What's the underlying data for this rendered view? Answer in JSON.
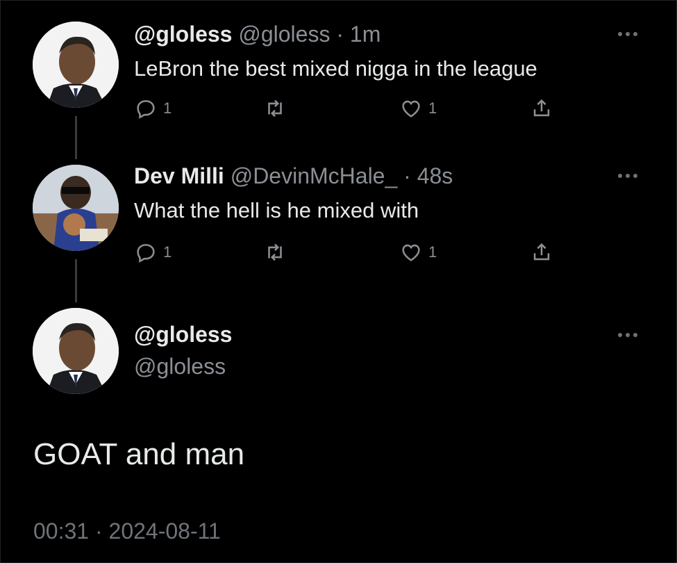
{
  "tweets": [
    {
      "name": "@gloless",
      "handle": "@gloless",
      "separator": "·",
      "time": "1m",
      "text": "LeBron the best mixed nigga in the league",
      "reply_count": "1",
      "like_count": "1"
    },
    {
      "name": "Dev Milli",
      "handle": "@DevinMcHale_",
      "separator": "·",
      "time": "48s",
      "text": "What the hell is he mixed with",
      "reply_count": "1",
      "like_count": "1"
    }
  ],
  "main": {
    "name": "@gloless",
    "handle": "@gloless",
    "text": "GOAT and man",
    "timestamp": "00:31 · 2024-08-11"
  },
  "icons": {
    "reply": "reply-icon",
    "retweet": "retweet-icon",
    "like": "heart-icon",
    "share": "share-icon",
    "more": "more-icon"
  },
  "colors": {
    "background": "#000000",
    "text": "#e7e9ea",
    "muted": "#8b8f94"
  }
}
